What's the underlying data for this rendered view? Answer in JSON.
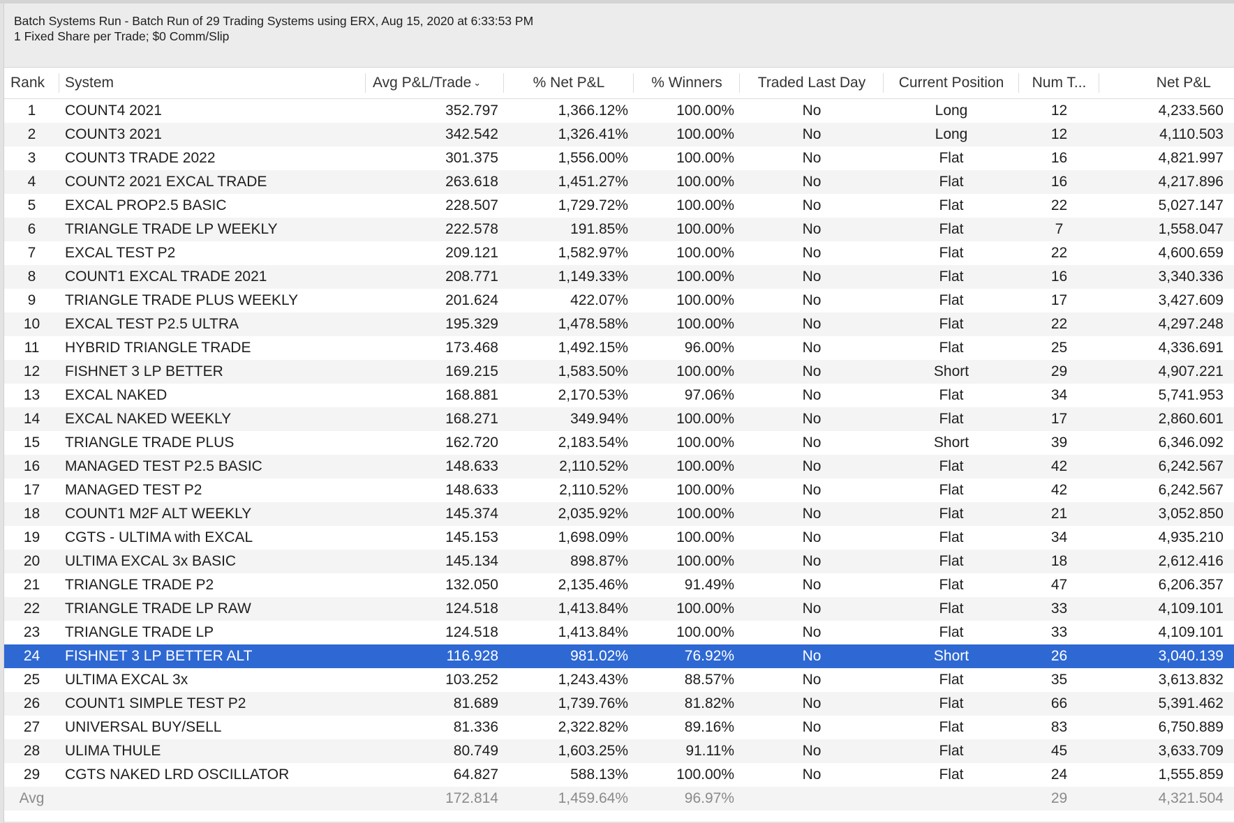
{
  "summary": {
    "line1": "Batch Systems Run - Batch Run of 29 Trading Systems using ERX, Aug 15, 2020 at 6:33:53 PM",
    "line2": "1 Fixed Share per Trade; $0 Comm/Slip"
  },
  "columns": [
    "Rank",
    "System",
    "Avg P&L/Trade",
    "% Net P&L",
    "% Winners",
    "Traded Last Day",
    "Current Position",
    "Num T...",
    "Net P&L"
  ],
  "sort_icon": "chevron-down-icon",
  "selected_rank": 24,
  "selection_color": "#2e68d3",
  "rows": [
    [
      "1",
      "COUNT4 2021",
      "352.797",
      "1,366.12%",
      "100.00%",
      "No",
      "Long",
      "12",
      "4,233.560"
    ],
    [
      "2",
      "COUNT3 2021",
      "342.542",
      "1,326.41%",
      "100.00%",
      "No",
      "Long",
      "12",
      "4,110.503"
    ],
    [
      "3",
      "COUNT3 TRADE 2022",
      "301.375",
      "1,556.00%",
      "100.00%",
      "No",
      "Flat",
      "16",
      "4,821.997"
    ],
    [
      "4",
      "COUNT2 2021  EXCAL TRADE",
      "263.618",
      "1,451.27%",
      "100.00%",
      "No",
      "Flat",
      "16",
      "4,217.896"
    ],
    [
      "5",
      "EXCAL PROP2.5 BASIC",
      "228.507",
      "1,729.72%",
      "100.00%",
      "No",
      "Flat",
      "22",
      "5,027.147"
    ],
    [
      "6",
      "TRIANGLE TRADE LP WEEKLY",
      "222.578",
      "191.85%",
      "100.00%",
      "No",
      "Flat",
      "7",
      "1,558.047"
    ],
    [
      "7",
      "EXCAL  TEST P2",
      "209.121",
      "1,582.97%",
      "100.00%",
      "No",
      "Flat",
      "22",
      "4,600.659"
    ],
    [
      "8",
      "COUNT1 EXCAL TRADE 2021",
      "208.771",
      "1,149.33%",
      "100.00%",
      "No",
      "Flat",
      "16",
      "3,340.336"
    ],
    [
      "9",
      "TRIANGLE TRADE PLUS WEEKLY",
      "201.624",
      "422.07%",
      "100.00%",
      "No",
      "Flat",
      "17",
      "3,427.609"
    ],
    [
      "10",
      "EXCAL  TEST P2.5 ULTRA",
      "195.329",
      "1,478.58%",
      "100.00%",
      "No",
      "Flat",
      "22",
      "4,297.248"
    ],
    [
      "11",
      "HYBRID TRIANGLE TRADE",
      "173.468",
      "1,492.15%",
      "96.00%",
      "No",
      "Flat",
      "25",
      "4,336.691"
    ],
    [
      "12",
      "FISHNET 3 LP BETTER",
      "169.215",
      "1,583.50%",
      "100.00%",
      "No",
      "Short",
      "29",
      "4,907.221"
    ],
    [
      "13",
      "EXCAL NAKED",
      "168.881",
      "2,170.53%",
      "97.06%",
      "No",
      "Flat",
      "34",
      "5,741.953"
    ],
    [
      "14",
      "EXCAL NAKED WEEKLY",
      "168.271",
      "349.94%",
      "100.00%",
      "No",
      "Flat",
      "17",
      "2,860.601"
    ],
    [
      "15",
      "TRIANGLE TRADE PLUS",
      "162.720",
      "2,183.54%",
      "100.00%",
      "No",
      "Short",
      "39",
      "6,346.092"
    ],
    [
      "16",
      "MANAGED  TEST P2.5 BASIC",
      "148.633",
      "2,110.52%",
      "100.00%",
      "No",
      "Flat",
      "42",
      "6,242.567"
    ],
    [
      "17",
      "MANAGED  TEST P2",
      "148.633",
      "2,110.52%",
      "100.00%",
      "No",
      "Flat",
      "42",
      "6,242.567"
    ],
    [
      "18",
      "COUNT1 M2F ALT WEEKLY",
      "145.374",
      "2,035.92%",
      "100.00%",
      "No",
      "Flat",
      "21",
      "3,052.850"
    ],
    [
      "19",
      "CGTS - ULTIMA with EXCAL",
      "145.153",
      "1,698.09%",
      "100.00%",
      "No",
      "Flat",
      "34",
      "4,935.210"
    ],
    [
      "20",
      "ULTIMA EXCAL 3x BASIC",
      "145.134",
      "898.87%",
      "100.00%",
      "No",
      "Flat",
      "18",
      "2,612.416"
    ],
    [
      "21",
      "TRIANGLE TRADE P2",
      "132.050",
      "2,135.46%",
      "91.49%",
      "No",
      "Flat",
      "47",
      "6,206.357"
    ],
    [
      "22",
      "TRIANGLE TRADE LP RAW",
      "124.518",
      "1,413.84%",
      "100.00%",
      "No",
      "Flat",
      "33",
      "4,109.101"
    ],
    [
      "23",
      "TRIANGLE TRADE LP",
      "124.518",
      "1,413.84%",
      "100.00%",
      "No",
      "Flat",
      "33",
      "4,109.101"
    ],
    [
      "24",
      "FISHNET 3 LP BETTER ALT",
      "116.928",
      "981.02%",
      "76.92%",
      "No",
      "Short",
      "26",
      "3,040.139"
    ],
    [
      "25",
      "ULTIMA EXCAL 3x",
      "103.252",
      "1,243.43%",
      "88.57%",
      "No",
      "Flat",
      "35",
      "3,613.832"
    ],
    [
      "26",
      "COUNT1 SIMPLE TEST P2",
      "81.689",
      "1,739.76%",
      "81.82%",
      "No",
      "Flat",
      "66",
      "5,391.462"
    ],
    [
      "27",
      "UNIVERSAL BUY/SELL",
      "81.336",
      "2,322.82%",
      "89.16%",
      "No",
      "Flat",
      "83",
      "6,750.889"
    ],
    [
      "28",
      "ULIMA THULE",
      "80.749",
      "1,603.25%",
      "91.11%",
      "No",
      "Flat",
      "45",
      "3,633.709"
    ],
    [
      "29",
      "CGTS NAKED LRD OSCILLATOR",
      "64.827",
      "588.13%",
      "100.00%",
      "No",
      "Flat",
      "24",
      "1,555.859"
    ]
  ],
  "avg_row": [
    "Avg",
    "",
    "172.814",
    "1,459.64%",
    "96.97%",
    "",
    "",
    "29",
    "4,321.504"
  ]
}
